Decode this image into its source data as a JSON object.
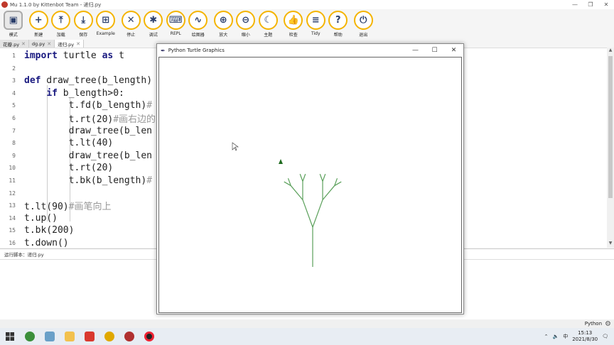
{
  "window": {
    "title": "Mu 1.1.0 by Kittenbot Team - 递归.py",
    "min": "—",
    "max": "❐",
    "close": "✕"
  },
  "toolbar": [
    {
      "id": "mode",
      "label": "模式",
      "icon": "mode-icon"
    },
    {
      "id": "new",
      "label": "新建",
      "icon": "plus-icon"
    },
    {
      "id": "load",
      "label": "加载",
      "icon": "upload-icon"
    },
    {
      "id": "save",
      "label": "保存",
      "icon": "download-icon"
    },
    {
      "id": "example",
      "label": "Example",
      "icon": "example-icon"
    },
    {
      "id": "stop",
      "label": "停止",
      "icon": "stop-icon"
    },
    {
      "id": "debug",
      "label": "调试",
      "icon": "bug-icon"
    },
    {
      "id": "repl",
      "label": "REPL",
      "icon": "keyboard-icon"
    },
    {
      "id": "plotter",
      "label": "绘图器",
      "icon": "wave-icon"
    },
    {
      "id": "zoomin",
      "label": "放大",
      "icon": "zoom-in-icon"
    },
    {
      "id": "zoomout",
      "label": "缩小",
      "icon": "zoom-out-icon"
    },
    {
      "id": "theme",
      "label": "主题",
      "icon": "moon-icon"
    },
    {
      "id": "check",
      "label": "检查",
      "icon": "thumbs-up-icon"
    },
    {
      "id": "tidy",
      "label": "Tidy",
      "icon": "menu-icon"
    },
    {
      "id": "help",
      "label": "帮助",
      "icon": "help-icon"
    },
    {
      "id": "quit",
      "label": "退出",
      "icon": "power-icon"
    }
  ],
  "tabs": [
    {
      "label": "花瓣.py",
      "active": false
    },
    {
      "label": "dg.py",
      "active": false
    },
    {
      "label": "递归.py",
      "active": true
    }
  ],
  "editor": {
    "lines": [
      {
        "n": "1",
        "text": "import turtle as t"
      },
      {
        "n": "2",
        "text": ""
      },
      {
        "n": "3",
        "text": "def draw_tree(b_length)"
      },
      {
        "n": "4",
        "text": "    if b_length>0:"
      },
      {
        "n": "5",
        "text": "        t.fd(b_length)#"
      },
      {
        "n": "6",
        "text": "        t.rt(20)#画右边的"
      },
      {
        "n": "7",
        "text": "        draw_tree(b_len"
      },
      {
        "n": "8",
        "text": "        t.lt(40)"
      },
      {
        "n": "9",
        "text": "        draw_tree(b_len"
      },
      {
        "n": "10",
        "text": "        t.rt(20)"
      },
      {
        "n": "11",
        "text": "        t.bk(b_length)#"
      },
      {
        "n": "12",
        "text": ""
      },
      {
        "n": "13",
        "text": "t.lt(90)#画笔向上"
      },
      {
        "n": "14",
        "text": "t.up()"
      },
      {
        "n": "15",
        "text": "t.bk(200)"
      },
      {
        "n": "16",
        "text": "t.down()"
      }
    ]
  },
  "run_panel": {
    "label": "运行脚本：递归.py"
  },
  "status": {
    "mode": "Python"
  },
  "turtle": {
    "title": "Python Turtle Graphics",
    "min": "—",
    "max": "☐",
    "close": "✕",
    "pen_color": "#5aa05a",
    "turtle_color": "#1f6b1f"
  },
  "taskbar": {
    "time": "15:13",
    "date": "2021/8/30",
    "ime": "中",
    "apps": [
      "windows",
      "search",
      "edge",
      "files",
      "wps",
      "chrome",
      "mu",
      "record"
    ]
  }
}
